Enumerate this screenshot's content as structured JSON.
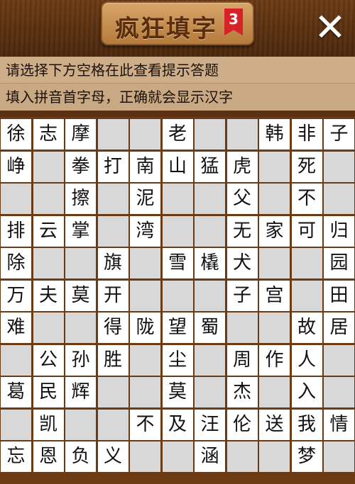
{
  "header": {
    "title": "疯狂填字",
    "level": "3",
    "close_symbol": "✕"
  },
  "hints": {
    "line1": "请选择下方空格在此查看提示答题",
    "line2": "填入拼音首字母，正确就会显示汉字"
  },
  "board": {
    "columns": 11,
    "rows": [
      [
        "徐",
        "志",
        "摩",
        "#",
        "#",
        "老",
        "#",
        "#",
        "韩",
        "非",
        "子"
      ],
      [
        "峥",
        "#",
        "拳",
        "打",
        "南",
        "山",
        "猛",
        "虎",
        "#",
        "死",
        "#"
      ],
      [
        "#",
        "#",
        "擦",
        "#",
        "泥",
        "#",
        "#",
        "父",
        "#",
        "不",
        "#"
      ],
      [
        "排",
        "云",
        "掌",
        "#",
        "湾",
        "#",
        "#",
        "无",
        "家",
        "可",
        "归"
      ],
      [
        "除",
        "#",
        "#",
        "旗",
        "#",
        "雪",
        "橇",
        "犬",
        "#",
        "#",
        "园"
      ],
      [
        "万",
        "夫",
        "莫",
        "开",
        "#",
        "#",
        "#",
        "子",
        "宫",
        "#",
        "田"
      ],
      [
        "难",
        "#",
        "#",
        "得",
        "陇",
        "望",
        "蜀",
        "#",
        "#",
        "故",
        "居"
      ],
      [
        "#",
        "公",
        "孙",
        "胜",
        "#",
        "尘",
        "#",
        "周",
        "作",
        "人",
        "#"
      ],
      [
        "葛",
        "民",
        "辉",
        "#",
        "#",
        "莫",
        "#",
        "杰",
        "#",
        "入",
        "#"
      ],
      [
        "#",
        "凯",
        "#",
        "#",
        "不",
        "及",
        "汪",
        "伦",
        "送",
        "我",
        "情"
      ],
      [
        "忘",
        "恩",
        "负",
        "义",
        "#",
        "#",
        "涵",
        "#",
        "#",
        "梦",
        "#"
      ]
    ]
  }
}
